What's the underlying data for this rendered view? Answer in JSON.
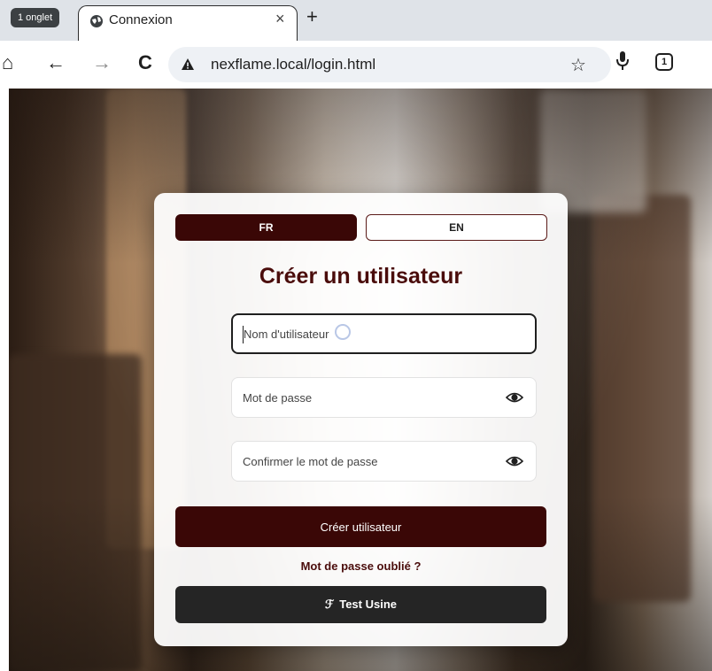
{
  "browser": {
    "tab_count_label": "1 onglet",
    "tab": {
      "title": "Connexion",
      "close": "×"
    },
    "new_tab": "+",
    "nav": {
      "home": "⌂",
      "back": "←",
      "forward": "→",
      "reload": "C"
    },
    "url": "nexflame.local/login.html",
    "bookmark_star": "☆",
    "tab_switcher_count": "1"
  },
  "form": {
    "lang_fr": "FR",
    "lang_en": "EN",
    "title": "Créer un utilisateur",
    "username_placeholder": "Nom d'utilisateur",
    "password_placeholder": "Mot de passe",
    "confirm_placeholder": "Confirmer le mot de passe",
    "create_button": "Créer utilisateur",
    "forgot_link": "Mot de passe oublié ?",
    "test_button": "Test Usine",
    "test_icon": "ℱ"
  },
  "colors": {
    "primary": "#3a0706",
    "title": "#4a0c0b",
    "secondary_button": "#252525"
  },
  "icons": [
    "globe-icon",
    "close-icon",
    "plus-icon",
    "home-icon",
    "back-arrow-icon",
    "forward-arrow-icon",
    "reload-icon",
    "warning-icon",
    "star-icon",
    "microphone-icon",
    "tab-switcher-icon",
    "eye-icon",
    "wrench-icon"
  ]
}
